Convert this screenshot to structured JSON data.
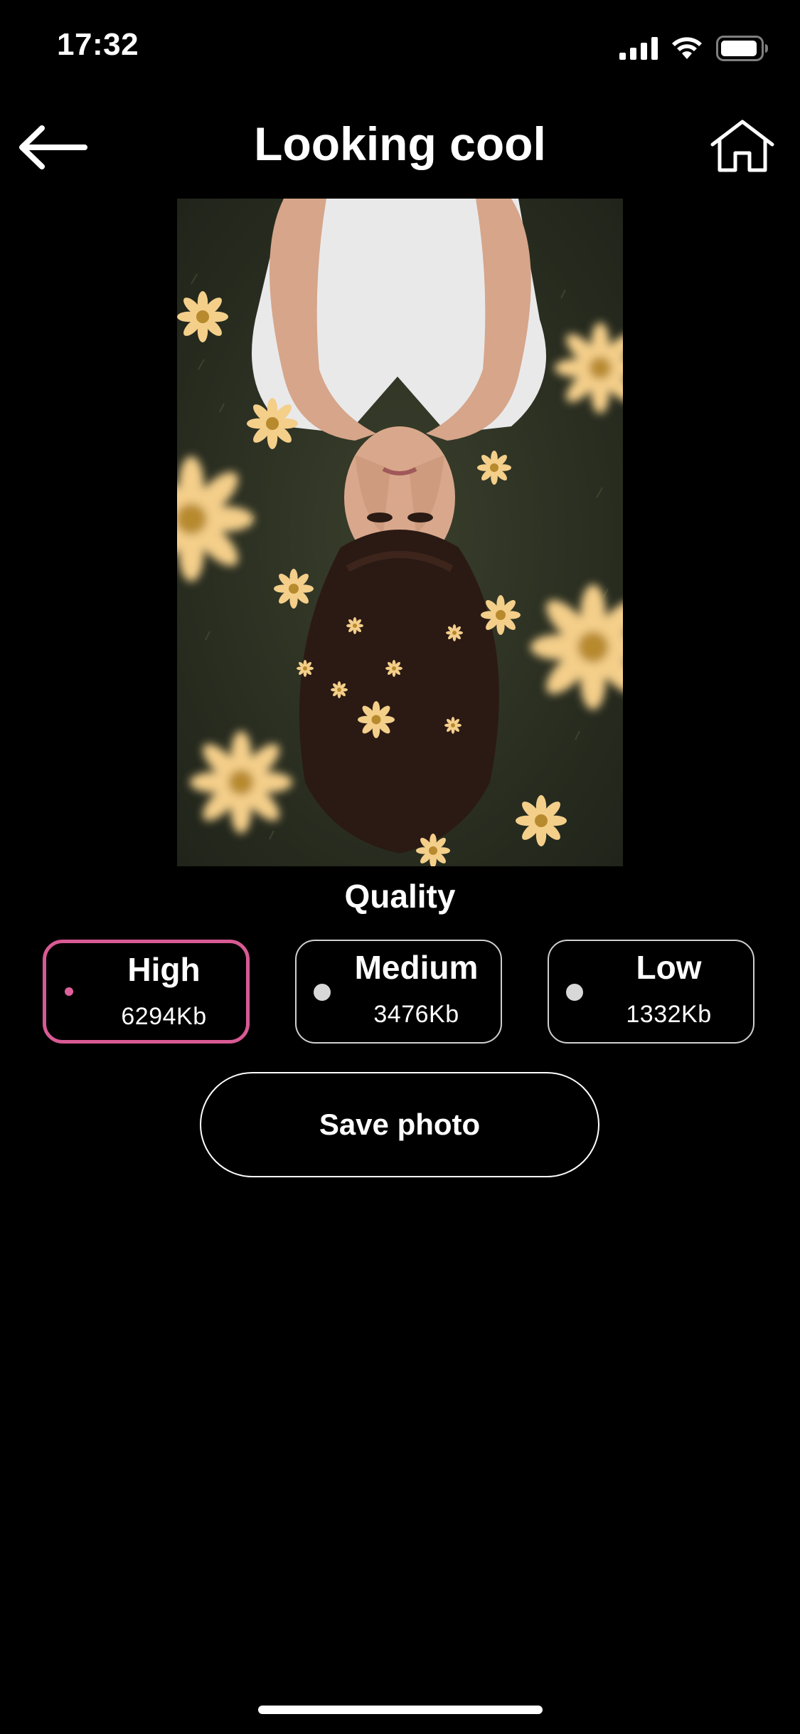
{
  "status_bar": {
    "time": "17:32",
    "icons": [
      "cellular-signal-icon",
      "wifi-icon",
      "battery-icon"
    ]
  },
  "header": {
    "title": "Looking cool",
    "back_icon": "arrow-left-icon",
    "home_icon": "home-icon"
  },
  "photo": {
    "description_icon": "photo-preview"
  },
  "quality": {
    "title": "Quality",
    "options": [
      {
        "label": "High",
        "size": "6294Kb",
        "selected": true
      },
      {
        "label": "Medium",
        "size": "3476Kb",
        "selected": false
      },
      {
        "label": "Low",
        "size": "1332Kb",
        "selected": false
      }
    ]
  },
  "actions": {
    "save_label": "Save photo"
  },
  "colors": {
    "background": "#000000",
    "selected_accent": "#d85a94",
    "text": "#ffffff"
  }
}
